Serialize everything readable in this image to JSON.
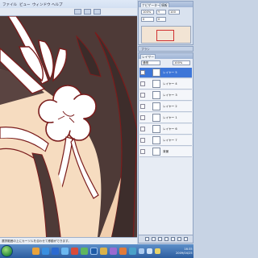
{
  "menubar": {
    "items": [
      "ファイル",
      "ビュー",
      "ウィンドウ",
      "ヘルプ"
    ]
  },
  "navigator": {
    "tabs": [
      "ナビゲーター",
      "情報"
    ],
    "fields": [
      "100%",
      "Y",
      "100",
      "0",
      "0"
    ]
  },
  "char_panel": {
    "label": "ブラシ"
  },
  "layers_panel": {
    "header_tab": "レイヤー",
    "blend_mode": "通常",
    "opacity": "100%",
    "layers": [
      {
        "name": "レイヤー 5",
        "selected": true
      },
      {
        "name": "レイヤー 4",
        "selected": false
      },
      {
        "name": "レイヤー 3",
        "selected": false
      },
      {
        "name": "レイヤー 2",
        "selected": false
      },
      {
        "name": "レイヤー 1",
        "selected": false
      },
      {
        "name": "レイヤー 6",
        "selected": false
      },
      {
        "name": "レイヤー 7",
        "selected": false
      },
      {
        "name": "背景",
        "selected": false
      }
    ]
  },
  "status": {
    "text": "選択範囲の上にカーソルを合わせて移動ができます。"
  },
  "taskbar": {
    "time": "16:35",
    "date": "2009/04/25"
  },
  "colors": {
    "selected_layer": "#3d76d8",
    "accent": "#2c5d9f"
  }
}
